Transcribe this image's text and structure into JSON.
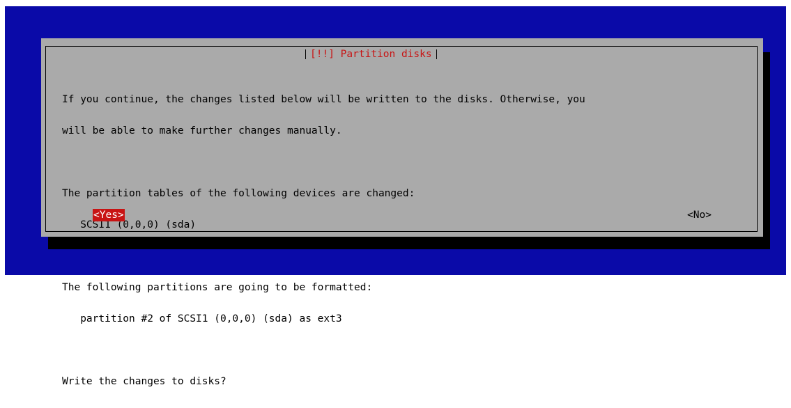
{
  "dialog": {
    "title": "[!!] Partition disks",
    "lines": [
      "If you continue, the changes listed below will be written to the disks. Otherwise, you",
      "will be able to make further changes manually.",
      "",
      "The partition tables of the following devices are changed:",
      "   SCSI1 (0,0,0) (sda)",
      "",
      "The following partitions are going to be formatted:",
      "   partition #2 of SCSI1 (0,0,0) (sda) as ext3",
      "",
      "Write the changes to disks?"
    ],
    "buttons": {
      "yes_label": "<Yes>",
      "no_label": "<No>",
      "selected": "yes"
    }
  },
  "colors": {
    "background": "#0a0aa8",
    "dialog": "#aaaaaa",
    "accent": "#c81414",
    "shadow": "#000000"
  }
}
